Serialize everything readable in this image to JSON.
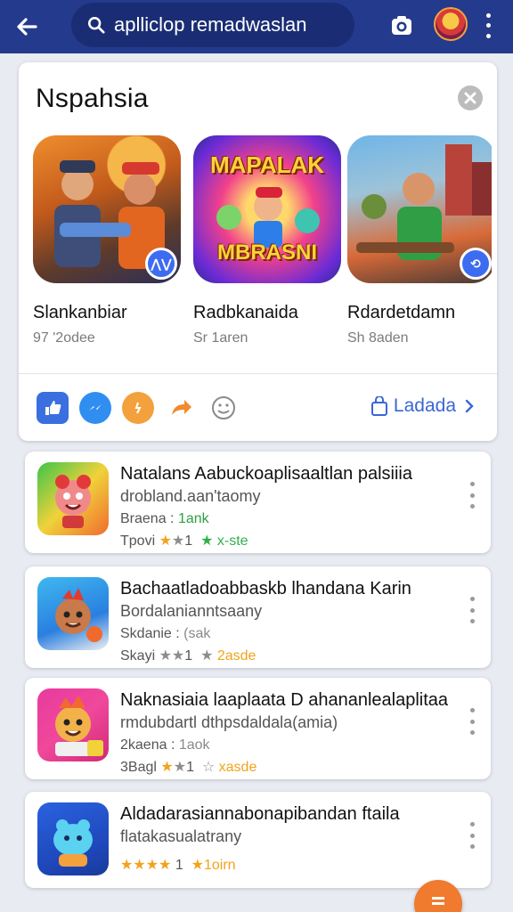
{
  "topbar": {
    "search_value": "aplliclop remadwaslan",
    "colors": {
      "bar": "#243a8c",
      "search": "#1a2d74"
    },
    "icons": [
      "back-arrow-icon",
      "search-icon",
      "camera-icon",
      "avatar",
      "more-vertical-icon"
    ]
  },
  "featured": {
    "title": "Nspahsia",
    "games": [
      {
        "name": "Slankanbiar",
        "meta": "97 '2odee",
        "art_text": ""
      },
      {
        "name": "Radbkanaida",
        "meta": "Sr 1aren",
        "art_text_1": "MAPALAK",
        "art_text_2": "MBRASNI"
      },
      {
        "name": "Rdardetdamn",
        "meta": "Sh 8aden",
        "art_text": ""
      }
    ],
    "share_icons": [
      "thumbs-up-icon",
      "messenger-icon",
      "chat-bubble-icon",
      "share-arrow-icon",
      "emoji-icon"
    ],
    "more_label": "Ladada"
  },
  "list": [
    {
      "title": "Natalans Aabuckoaplisaaltlan palsiiia",
      "subtitle": "drobland.aan'taomy",
      "size_label": "Braena :",
      "size_value": "1ank",
      "rating_prefix": "Tpovi",
      "rating_mid": "1",
      "rating_suffix": "x-ste"
    },
    {
      "title": "Bachaatladoabbaskb lhandana Karin",
      "subtitle": "Bordalanianntsaany",
      "size_label": "Skdanie :",
      "size_value": "(sak",
      "rating_prefix": "Skayi",
      "rating_mid": "1",
      "rating_suffix": "2asde"
    },
    {
      "title": "Naknasiaia laaplaata D ahananlealaplitaa",
      "subtitle": "rmdubdartl dthpsdaldala(amia)",
      "size_label": "2kaena :",
      "size_value": "1aok",
      "rating_prefix": "3Bagl",
      "rating_mid": "1",
      "rating_suffix": "xasde"
    },
    {
      "title": "Aldadarasiannabonapibandan ftaila",
      "subtitle": "flatakasualatrany",
      "rating_mid": "1",
      "rating_suffix": "1oirn"
    }
  ]
}
